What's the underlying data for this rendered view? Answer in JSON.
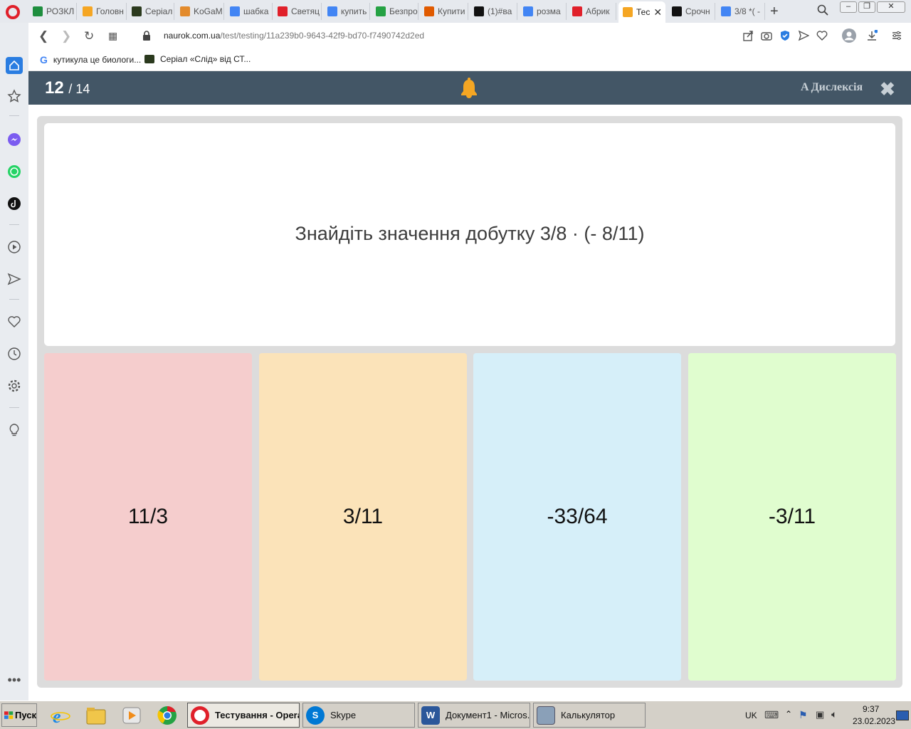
{
  "browser": {
    "tabs": [
      {
        "label": "РОЗКЛ",
        "color": "#1e8e3e"
      },
      {
        "label": "Головн",
        "color": "#f5a623"
      },
      {
        "label": "Серіал",
        "color": "#2b3a1e"
      },
      {
        "label": "KoGaM",
        "color": "#e38b2c"
      },
      {
        "label": "шабка",
        "color": "#4285f4"
      },
      {
        "label": "Светяц",
        "color": "#e0202a"
      },
      {
        "label": "купить",
        "color": "#4285f4"
      },
      {
        "label": "Безпро",
        "color": "#25a244"
      },
      {
        "label": "Купити",
        "color": "#e05a00"
      },
      {
        "label": "(1)#ва",
        "color": "#111111"
      },
      {
        "label": "розма",
        "color": "#4285f4"
      },
      {
        "label": "Абрик",
        "color": "#e0202a"
      },
      {
        "label": "Тес",
        "color": "#f5a623",
        "active": true
      },
      {
        "label": "Срочн",
        "color": "#111111"
      },
      {
        "label": "3/8 *( -",
        "color": "#4285f4"
      }
    ],
    "new_tab": "+",
    "close_tab": "✕",
    "url_host": "naurok.com.ua",
    "url_path": "/test/testing/11a239b0-9643-42f9-bd70-f7490742d2ed",
    "bookmarks": [
      {
        "label": "кутикула це биологи..."
      },
      {
        "label": "Серіал «Слід» від СТ..."
      }
    ],
    "window_buttons": [
      "‒",
      "❐",
      "✕"
    ]
  },
  "test": {
    "current": "12",
    "total": "/ 14",
    "dyslexia_label": "A Дислексія",
    "close_symbol": "✖",
    "question": "Знайдіть значення добутку 3/8 · (- 8/11)",
    "answers": [
      {
        "label": "11/3",
        "color": "#f5cdcd"
      },
      {
        "label": "3/11",
        "color": "#fbe3b9"
      },
      {
        "label": "-33/64",
        "color": "#d6eff9"
      },
      {
        "label": "-3/11",
        "color": "#e0fdcf"
      }
    ]
  },
  "taskbar": {
    "start_label": "Пуск",
    "tasks": [
      {
        "label": "Тестування - Opera",
        "active": true,
        "color": "#e0202a"
      },
      {
        "label": "Skype",
        "active": false,
        "color": "#0078d4"
      },
      {
        "label": "Документ1 - Micros...",
        "active": false,
        "color": "#2b579a"
      },
      {
        "label": "Калькулятор",
        "active": false,
        "color": "#8aa0b8"
      }
    ],
    "language": "UK",
    "time": "9:37",
    "date": "23.02.2023"
  }
}
